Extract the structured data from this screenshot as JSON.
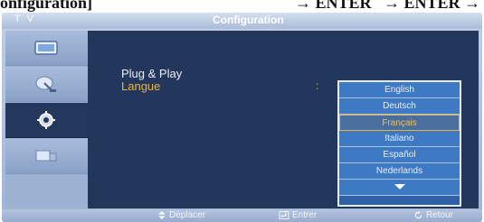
{
  "doc_caption": {
    "part1": "onfiguration]",
    "part2": "→ ENTER",
    "part3": "→ ENTER → [Lang"
  },
  "titlebar": {
    "tv_label": "T V",
    "title": "Configuration"
  },
  "sidebar": {
    "items": [
      {
        "icon": "picture-icon"
      },
      {
        "icon": "satellite-dish-icon"
      },
      {
        "icon": "gear-icon",
        "active": true
      },
      {
        "icon": "input-icon"
      }
    ]
  },
  "menu": {
    "items": [
      {
        "label": "Plug & Play"
      },
      {
        "label": "Langue",
        "selected": true
      }
    ],
    "colon": ":"
  },
  "dropdown": {
    "options": [
      "English",
      "Deutsch",
      "Français",
      "Italiano",
      "Español",
      "Nederlands"
    ],
    "highlighted": "Français",
    "more_icon": "down-triangle-icon"
  },
  "footer": {
    "move": "Déplacer",
    "enter": "Entrer",
    "return": "Retour"
  },
  "colors": {
    "frame": "#a9bbd9",
    "content_bg": "#23375c",
    "selected_text": "#e8b43a",
    "dropdown_item": "#3e79c4",
    "highlight_border": "#e6b33b"
  }
}
